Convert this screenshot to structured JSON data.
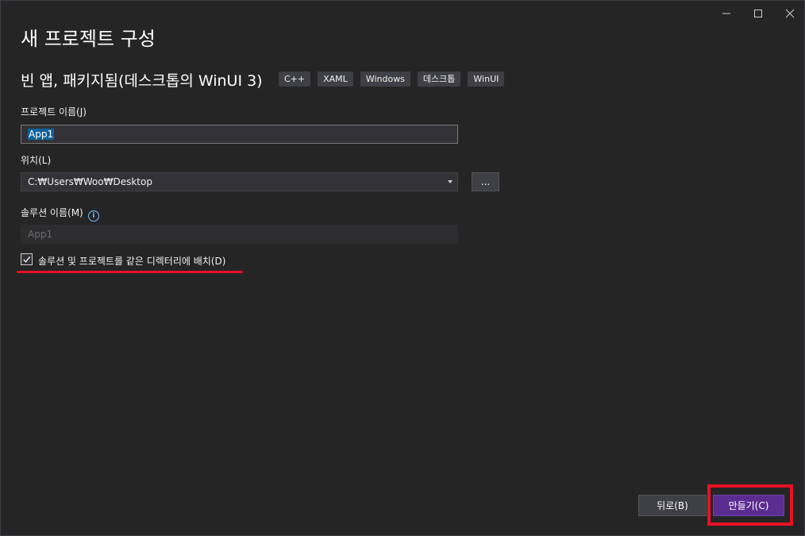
{
  "window": {
    "controls": [
      "minimize-icon",
      "maximize-icon",
      "close-icon"
    ]
  },
  "header": {
    "title": "새 프로젝트 구성",
    "template_name": "빈 앱, 패키지됨(데스크톱의 WinUI 3)",
    "tags": [
      "C++",
      "XAML",
      "Windows",
      "데스크톱",
      "WinUI"
    ]
  },
  "form": {
    "project_name_label": "프로젝트 이름(J)",
    "project_name_value": "App1",
    "location_label": "위치(L)",
    "location_value": "C:₩Users₩Woo₩Desktop",
    "browse_label": "...",
    "solution_name_label": "솔루션 이름(M)",
    "solution_name_placeholder": "App1",
    "same_dir_checkbox_label": "솔루션 및 프로젝트를 같은 디렉터리에 배치(D)",
    "same_dir_checked": true
  },
  "footer": {
    "back_label": "뒤로(B)",
    "create_label": "만들기(C)"
  },
  "colors": {
    "background": "#252526",
    "accent": "#5c2d91",
    "annotation": "#e81123",
    "selection": "#0e639c"
  }
}
